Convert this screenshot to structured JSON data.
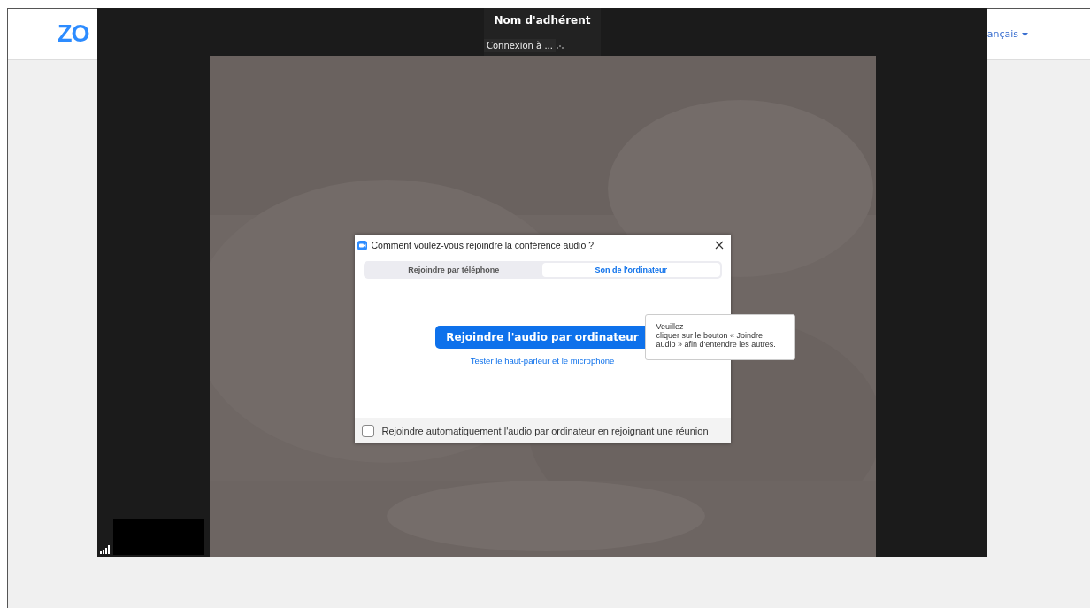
{
  "header": {
    "logo": "ZO",
    "language": "ançais"
  },
  "meeting": {
    "participant_name": "Nom d'adhérent",
    "status": "Connexion à ..."
  },
  "dialog": {
    "title": "Comment voulez-vous rejoindre la conférence audio ?",
    "tabs": [
      {
        "label": "Rejoindre par téléphone",
        "selected": false
      },
      {
        "label": "Son de l'ordinateur",
        "selected": true
      }
    ],
    "join_button": "Rejoindre l'audio par ordinateur",
    "test_link": "Tester le haut-parleur et le microphone",
    "tooltip": [
      "Veuillez",
      "cliquer sur le bouton « Joindre",
      "audio » afin d'entendre les autres."
    ],
    "auto_join": {
      "label": "Rejoindre automatiquement l'audio par ordinateur en rejoignant une réunion",
      "checked": false
    }
  }
}
